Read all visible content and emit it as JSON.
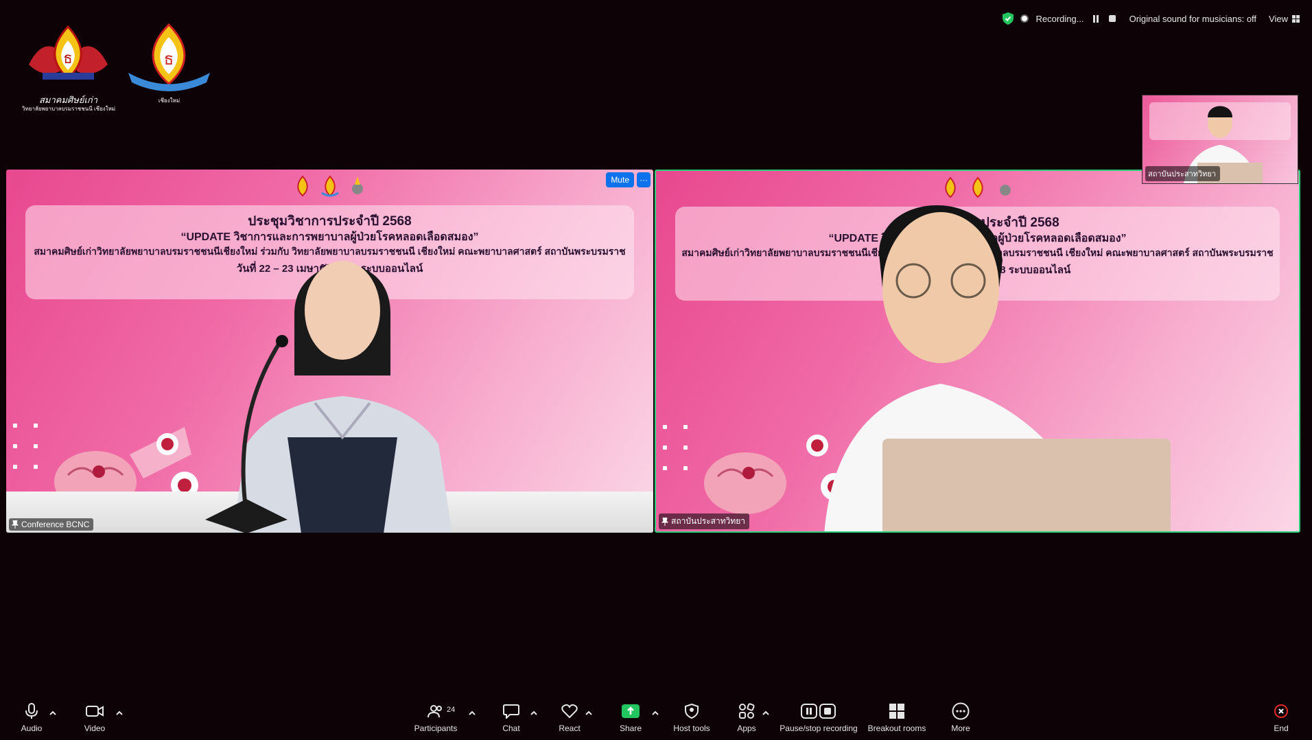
{
  "topbar": {
    "recording_label": "Recording...",
    "original_sound": "Original sound for musicians: off",
    "view_label": "View"
  },
  "logos": {
    "logo1_caption": "สมาคมศิษย์เก่า",
    "logo1_sub": "วิทยาลัยพยาบาลบรมราชชนนี เชียงใหม่",
    "logo2_caption": "เชียงใหม่"
  },
  "tiles": {
    "left": {
      "name": "Conference BCNC",
      "mute_label": "Mute",
      "more_label": "···",
      "banner": {
        "line1": "ประชุมวิชาการประจำปี 2568",
        "line2": "“UPDATE วิชาการและการพยาบาลผู้ป่วยโรคหลอดเลือดสมอง”",
        "line3": "สมาคมศิษย์เก่าวิทยาลัยพยาบาลบรมราชชนนีเชียงใหม่ ร่วมกับ วิทยาลัยพยาบาลบรมราชชนนี เชียงใหม่ คณะพยาบาลศาสตร์ สถาบันพระบรมราชชนก",
        "line4": "วันที่ 22 – 23 เมษายน 2568 ระบบออนไลน์"
      }
    },
    "right": {
      "name": "สถาบันประสาทวิทยา",
      "banner": {
        "line1": "ประชุมวิชาการประจำปี 2568",
        "line2": "“UPDATE วิชาการและการพยาบาลผู้ป่วยโรคหลอดเลือดสมอง”",
        "line3": "สมาคมศิษย์เก่าวิทยาลัยพยาบาลบรมราชชนนีเชียงใหม่ ร่วมกับ วิทยาลัยพยาบาลบรมราชชนนี เชียงใหม่ คณะพยาบาลศาสตร์ สถาบันพระบรมราชชนก",
        "line4": "วันที่ 22 – 23 เมษายน 2568 ระบบออนไลน์"
      }
    },
    "thumb": {
      "name": "สถาบันประสาทวิทยา"
    }
  },
  "toolbar": {
    "audio": "Audio",
    "video": "Video",
    "participants": "Participants",
    "participants_count": "24",
    "chat": "Chat",
    "react": "React",
    "share": "Share",
    "host_tools": "Host tools",
    "apps": "Apps",
    "pause_stop": "Pause/stop recording",
    "breakout": "Breakout rooms",
    "more": "More",
    "end": "End"
  },
  "colors": {
    "accent": "#0e72ed",
    "active_speaker": "#2ad07a",
    "share": "#22c55e",
    "end": "#e02828",
    "background": "#0d0205"
  }
}
